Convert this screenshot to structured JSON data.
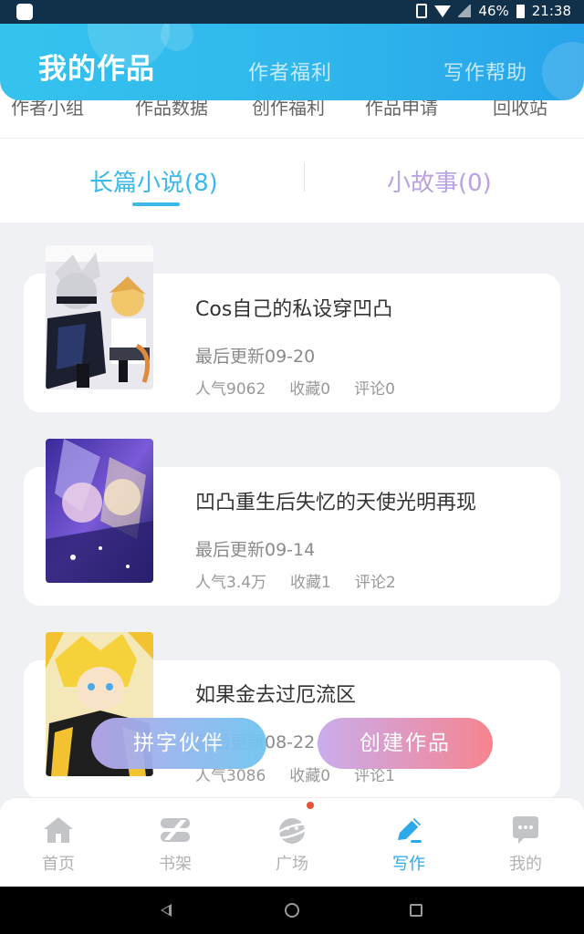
{
  "status_bar": {
    "battery": "46%",
    "time": "21:38"
  },
  "header": {
    "title": "我的作品",
    "tabs": [
      "作者福利",
      "写作帮助"
    ]
  },
  "quick_menu": [
    "作者小组",
    "作品数据",
    "创作福利",
    "作品申请",
    "回收站"
  ],
  "category_tabs": {
    "long": "长篇小说(8)",
    "short": "小故事(0)"
  },
  "works": [
    {
      "title": "Cos自己的私设穿凹凸",
      "updated": "最后更新09-20",
      "popularity": "人气9062",
      "favorites": "收藏0",
      "comments": "评论0"
    },
    {
      "title": "凹凸重生后失忆的天使光明再现",
      "updated": "最后更新09-14",
      "popularity": "人气3.4万",
      "favorites": "收藏1",
      "comments": "评论2"
    },
    {
      "title": "如果金去过厄流区",
      "updated": "最后更新08-22",
      "popularity": "人气3086",
      "favorites": "收藏0",
      "comments": "评论1"
    }
  ],
  "floating_buttons": {
    "partner": "拼字伙伴",
    "create": "创建作品"
  },
  "bottom_nav": [
    "首页",
    "书架",
    "广场",
    "写作",
    "我的"
  ],
  "colors": {
    "accent": "#2da8ea",
    "header_gradient_start": "#35c3ee",
    "header_gradient_end": "#27a4ea",
    "create_gradient_end": "#f6808c",
    "partner_gradient_end": "#6ec4f0",
    "notification_dot": "#e8533c"
  }
}
